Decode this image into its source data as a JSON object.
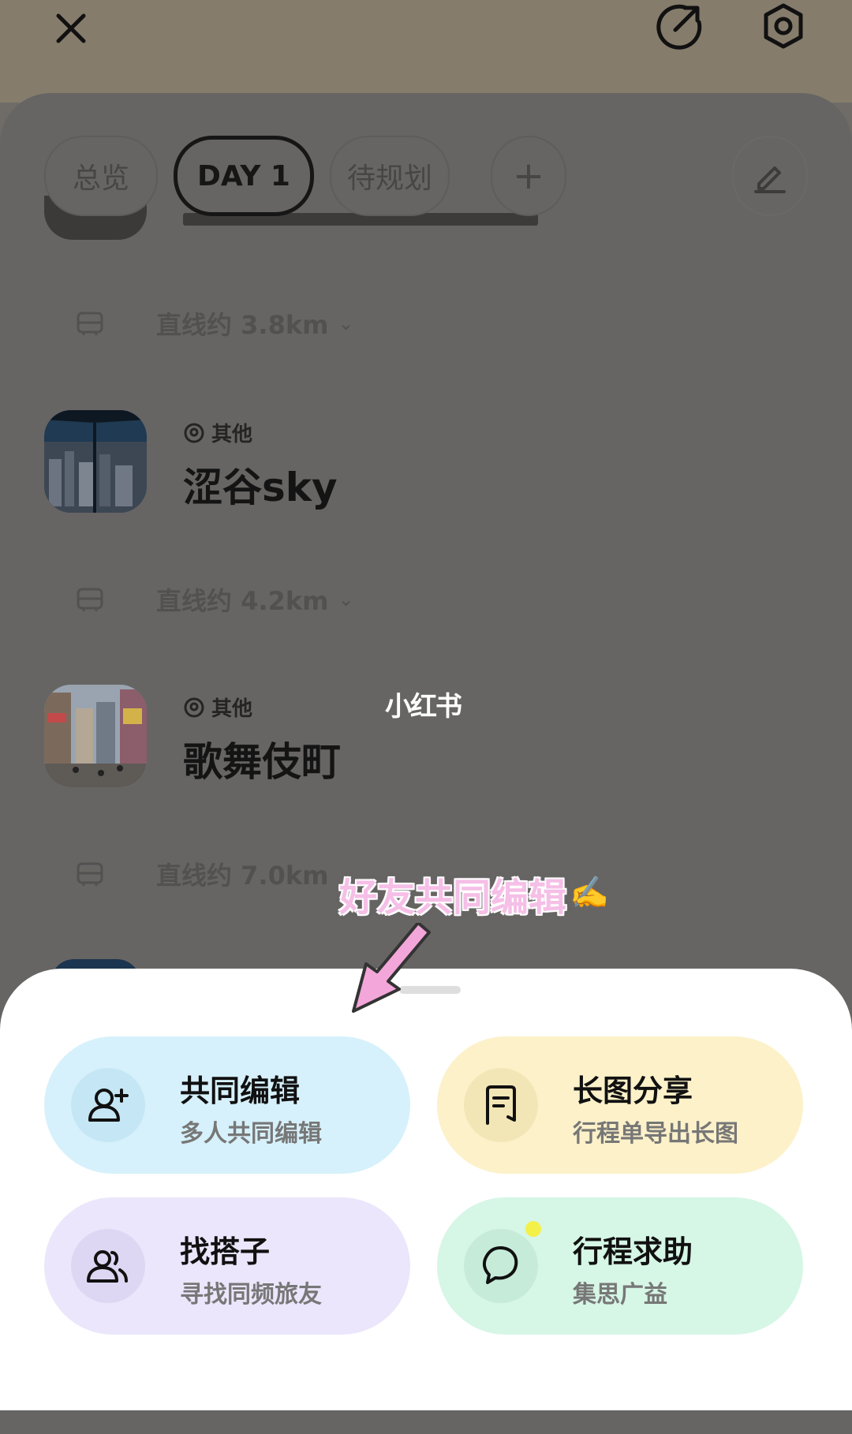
{
  "header": {
    "close_icon": "close-icon",
    "share_icon": "share-arrow-icon",
    "settings_icon": "hexagon-settings-icon"
  },
  "tabs": [
    {
      "label": "总览",
      "active": false
    },
    {
      "label": "DAY 1",
      "active": true
    },
    {
      "label": "待规划",
      "active": false
    },
    {
      "label": "+",
      "active": false
    }
  ],
  "itinerary": {
    "distances": [
      "直线约 3.8km",
      "直线约 4.2km",
      "直线约 7.0km"
    ],
    "places": [
      {
        "tag": "其他",
        "name": "涩谷sky"
      },
      {
        "tag": "其他",
        "name": "歌舞伎町"
      }
    ]
  },
  "watermark": "小红书",
  "callout": {
    "text": "好友共同编辑",
    "emoji": "✍️"
  },
  "actions": [
    {
      "title": "共同编辑",
      "subtitle": "多人共同编辑",
      "icon": "add-user-icon",
      "color": "#d6f1fb"
    },
    {
      "title": "长图分享",
      "subtitle": "行程单导出长图",
      "icon": "document-icon",
      "color": "#fcf1c9"
    },
    {
      "title": "找搭子",
      "subtitle": "寻找同频旅友",
      "icon": "users-icon",
      "color": "#ebe6fb"
    },
    {
      "title": "行程求助",
      "subtitle": "集思广益",
      "icon": "chat-bubble-icon",
      "color": "#d6f6e6"
    }
  ]
}
